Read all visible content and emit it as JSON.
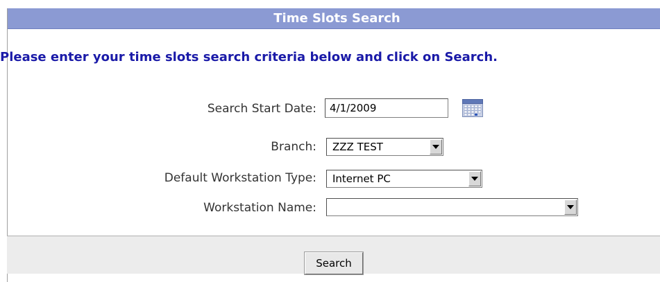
{
  "panel": {
    "title": "Time Slots Search",
    "instructions": "Please enter your time slots search criteria below and click on Search."
  },
  "form": {
    "start_date": {
      "label": "Search Start Date:",
      "value": "4/1/2009"
    },
    "branch": {
      "label": "Branch:",
      "selected": "ZZZ TEST"
    },
    "workstation_type": {
      "label": "Default Workstation Type:",
      "selected": "Internet PC"
    },
    "workstation_name": {
      "label": "Workstation Name:",
      "selected": ""
    }
  },
  "footer": {
    "search_label": "Search"
  },
  "icons": {
    "calendar": "calendar-icon",
    "dropdown": "chevron-down-icon"
  },
  "colors": {
    "header_bg": "#8b9ad3",
    "instruction_text": "#1a1aa8",
    "footer_bg": "#ececec"
  }
}
